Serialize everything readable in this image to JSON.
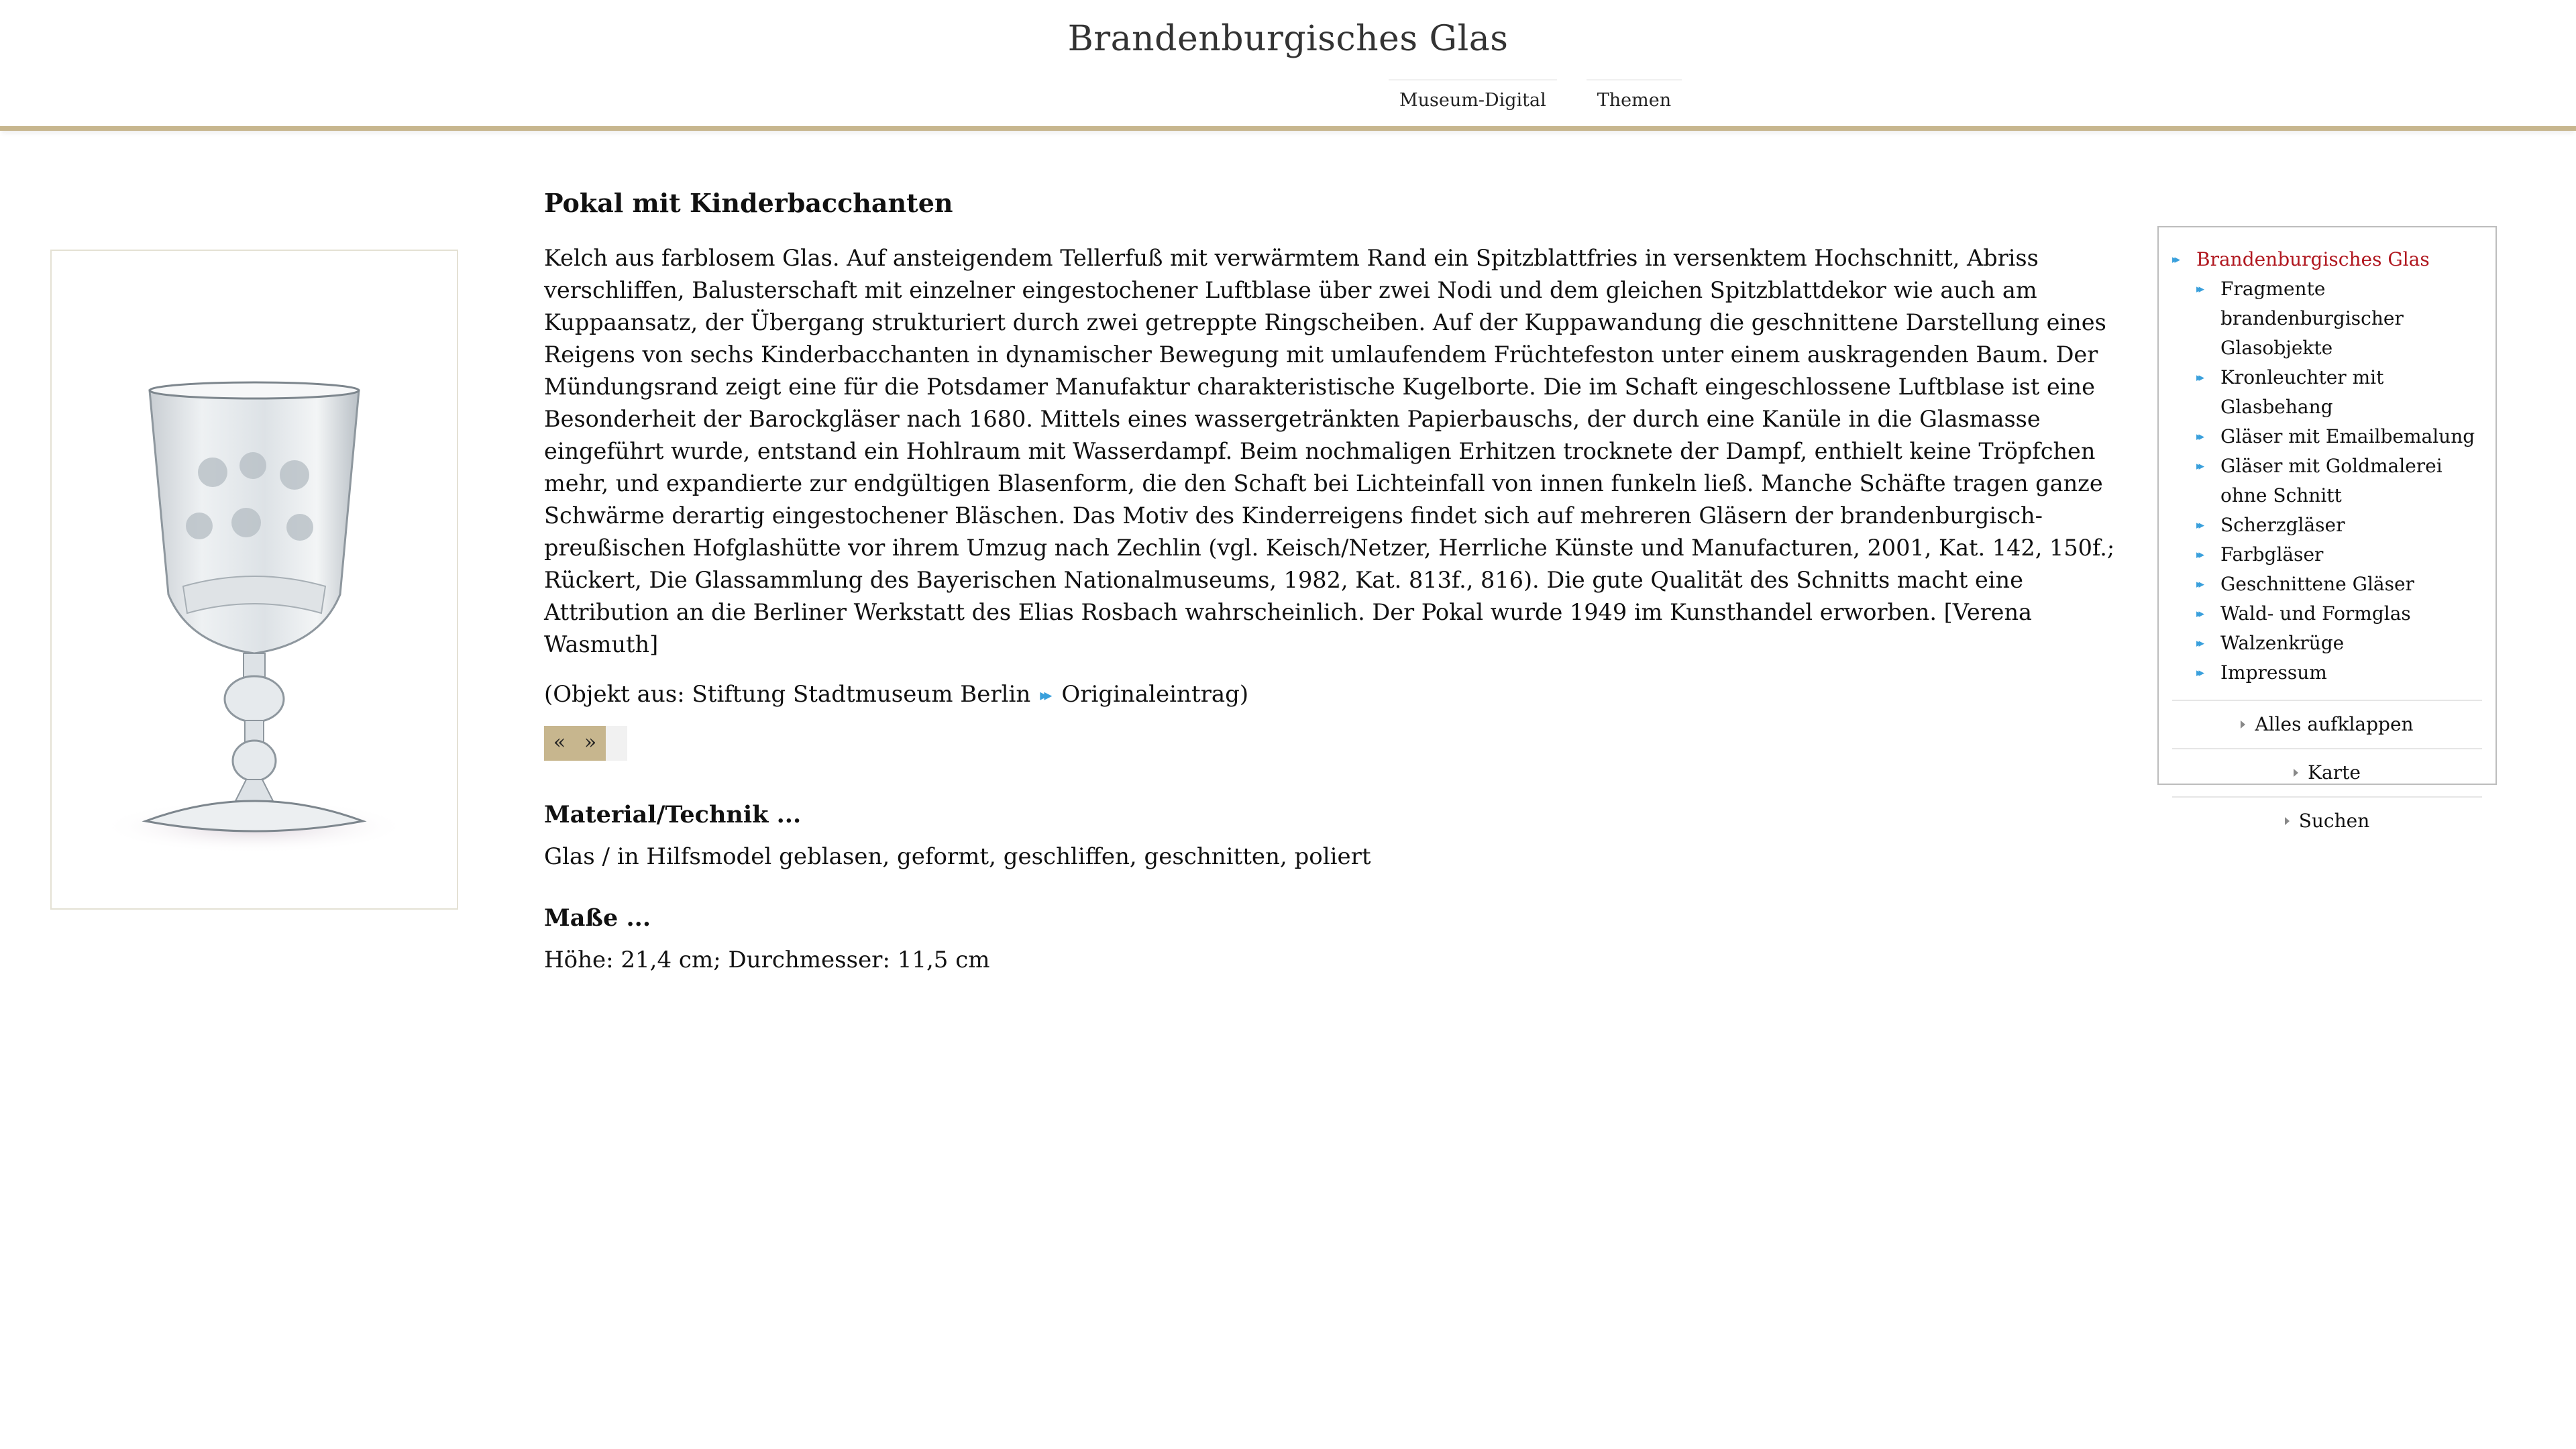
{
  "header": {
    "site_title": "Brandenburgisches Glas",
    "nav": [
      "Museum-Digital",
      "Themen"
    ]
  },
  "object": {
    "title": "Pokal mit Kinderbacchanten",
    "description": "Kelch aus farblosem Glas. Auf ansteigendem Tellerfuß mit verwärmtem Rand ein Spitzblattfries in versenktem Hochschnitt, Abriss verschliffen, Balusterschaft mit einzelner eingestochener Luftblase über zwei Nodi und dem gleichen Spitzblattdekor wie auch am Kuppaansatz, der Übergang strukturiert durch zwei getreppte Ringscheiben. Auf der Kuppawandung die geschnittene Darstellung eines Reigens von sechs Kinderbacchanten in dynamischer Bewegung mit umlaufendem Früchtefeston unter einem auskragenden Baum. Der Mündungsrand zeigt eine für die Potsdamer Manufaktur charakteristische Kugelborte. Die im Schaft eingeschlossene Luftblase ist eine Besonderheit der Barockgläser nach 1680. Mittels eines wassergetränkten Papierbauschs, der durch eine Kanüle in die Glasmasse eingeführt wurde, entstand ein Hohlraum mit Wasserdampf. Beim nochmaligen Erhitzen trocknete der Dampf, enthielt keine Tröpfchen mehr, und expandierte zur endgültigen Blasenform, die den Schaft bei Lichteinfall von innen funkeln ließ. Manche Schäfte tragen ganze Schwärme derartig eingestochener Bläschen. Das Motiv des Kinderreigens findet sich auf mehreren Gläsern der brandenburgisch-preußischen Hofglashütte vor ihrem Umzug nach Zechlin (vgl. Keisch/Netzer, Herrliche Künste und Manufacturen, 2001, Kat. 142, 150f.; Rückert, Die Glassammlung des Bayerischen Nationalmuseums, 1982, Kat. 813f., 816). Die gute Qualität des Schnitts macht eine Attribution an die Berliner Werkstatt des Elias Rosbach wahrscheinlich. Der Pokal wurde 1949 im Kunsthandel erworben. [Verena Wasmuth]",
    "source_prefix": "(Objekt aus: Stiftung Stadtmuseum Berlin",
    "source_link": "Originaleintrag)",
    "pager_prev": "«",
    "pager_next": "»"
  },
  "details": {
    "material_heading": "Material/Technik ...",
    "material_value": "Glas / in Hilfsmodel geblasen, geformt, geschliffen, geschnitten, poliert",
    "dimensions_heading": "Maße ...",
    "dimensions_value": "Höhe: 21,4 cm; Durchmesser: 11,5 cm"
  },
  "sidebar": {
    "active_item": "Brandenburgisches Glas",
    "items": [
      "Fragmente brandenburgischer Glasobjekte",
      "Kronleuchter mit Glasbehang",
      "Gläser mit Emailbemalung",
      "Gläser mit Goldmalerei ohne Schnitt",
      "Scherzgläser",
      "Farbgläser",
      "Geschnittene Gläser",
      "Wald- und Formglas",
      "Walzenkrüge",
      "Impressum"
    ],
    "actions": [
      "Alles aufklappen",
      "Karte",
      "Suchen"
    ]
  },
  "colors": {
    "accent": "#c7b68e",
    "active_link": "#b0171f",
    "bullet_icon": "#3aa0dc"
  },
  "icons": {
    "menu_bullet": "double-arrow-icon",
    "action_bullet": "triangle-right-icon"
  }
}
